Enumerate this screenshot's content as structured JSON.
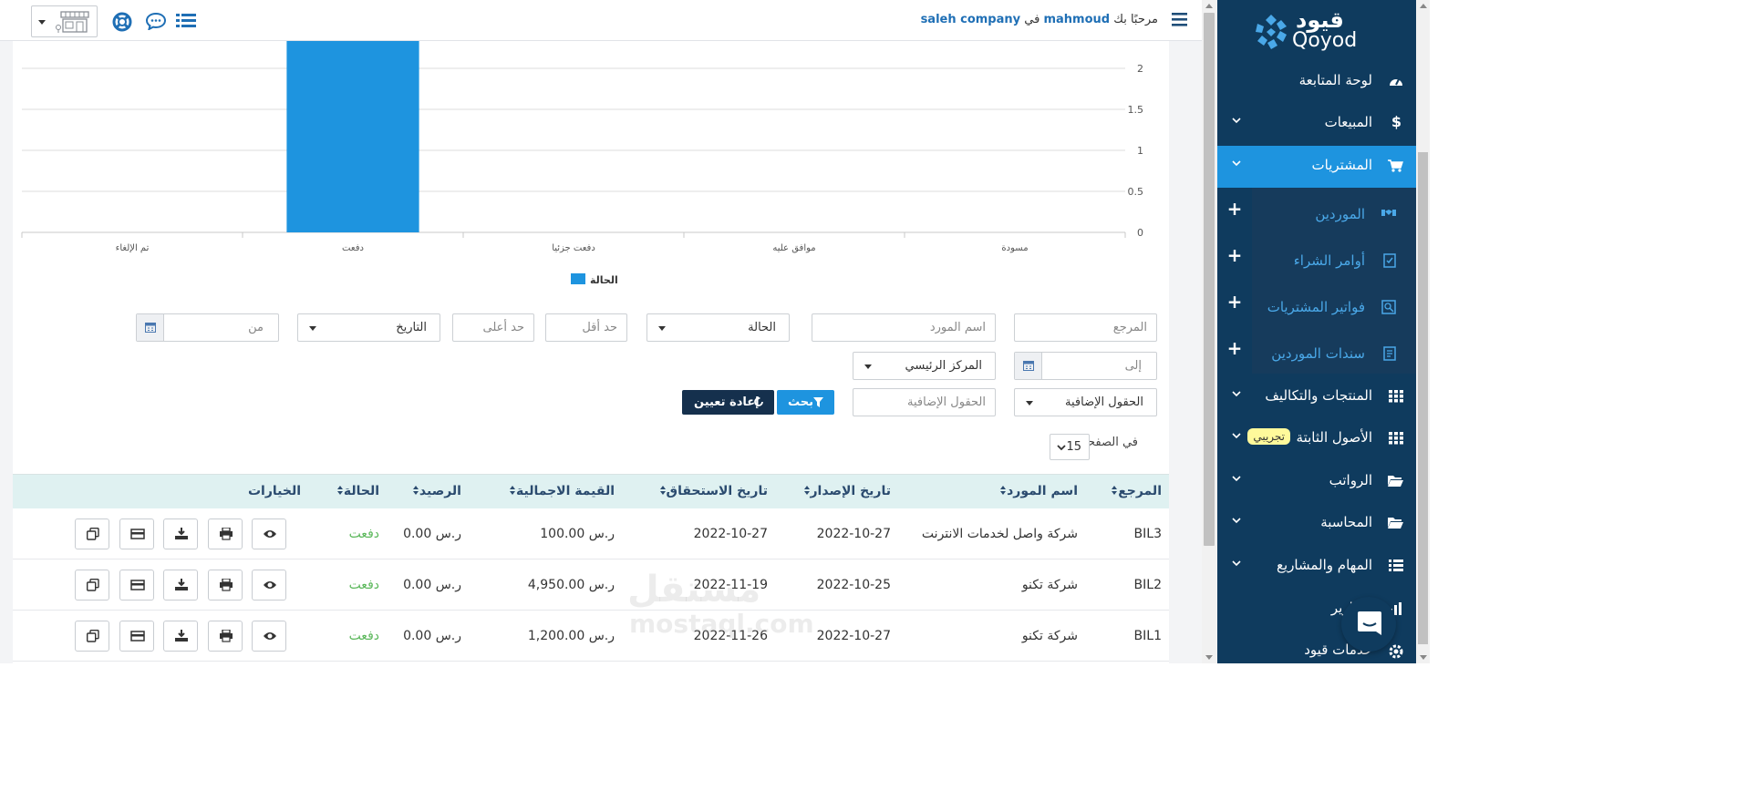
{
  "header": {
    "welcome": "مرحبًا بك",
    "username": "mahmoud",
    "in": "في",
    "company": "saleh company"
  },
  "brand": {
    "logo_ar": "قيود",
    "logo_en": "Qoyod"
  },
  "chart_data": {
    "type": "bar",
    "categories": [
      "مسودة",
      "موافق عليه",
      "دفعت جزئيا",
      "دفعت",
      "تم الإلغاء"
    ],
    "series": [
      {
        "name": "الحالة",
        "values": [
          0,
          0,
          0,
          3,
          0
        ]
      }
    ],
    "ylim": [
      0,
      2.4
    ],
    "yticks": [
      "0",
      "0.5",
      "1",
      "1.5",
      "2"
    ],
    "legend": "bottom-center",
    "grid": true,
    "color": "#1e94df"
  },
  "filters": {
    "reference_ph": "المرجع",
    "supplier_ph": "اسم المورد",
    "status": "الحالة",
    "min_ph": "حد أقل",
    "max_ph": "حد أعلى",
    "date_type": "التاريخ",
    "from_ph": "من",
    "to_ph": "إلى",
    "branch": "المركز الرئيسي",
    "extra_fields": "الحقول الإضافية",
    "extra_fields_ph": "الحقول الإضافية",
    "search": "بحث",
    "reset": "إعادة تعيين"
  },
  "pagination": {
    "per_page_label": "في الصفحة",
    "per_page": "15"
  },
  "table": {
    "headers": {
      "reference": "المرجع",
      "supplier": "اسم المورد",
      "issue_date": "تاريخ الإصدار",
      "due_date": "تاريخ الاستحقاق",
      "total": "القيمة الاجمالية",
      "balance": "الرصيد",
      "status": "الحالة",
      "options": "الخيارات"
    },
    "rows": [
      {
        "reference": "BIL3",
        "supplier": "شركة واصل لخدمات الانترنت",
        "issue_date": "2022-10-27",
        "due_date": "2022-10-27",
        "total": "100.00 ر.س",
        "balance": "0.00 ر.س",
        "status": "دفعت"
      },
      {
        "reference": "BIL2",
        "supplier": "شركة تكنو",
        "issue_date": "2022-10-25",
        "due_date": "2022-11-19",
        "total": "4,950.00 ر.س",
        "balance": "0.00 ر.س",
        "status": "دفعت"
      },
      {
        "reference": "BIL1",
        "supplier": "شركة تكنو",
        "issue_date": "2022-10-27",
        "due_date": "2022-11-26",
        "total": "1,200.00 ر.س",
        "balance": "0.00 ر.س",
        "status": "دفعت"
      }
    ]
  },
  "sidebar": {
    "dashboard": "لوحة المتابعة",
    "sales": "المبيعات",
    "purchases": "المشتريات",
    "suppliers": "الموردين",
    "purchase_orders": "أوامر الشراء",
    "purchase_invoices": "فواتير المشتريات",
    "supplier_receipts": "سندات الموردين",
    "products": "المنتجات والتكاليف",
    "fixed_assets": "الأصول الثابتة",
    "beta_badge": "تجريبي",
    "payroll": "الرواتب",
    "accounting": "المحاسبة",
    "tasks": "المهام والمشاريع",
    "reports": "التقارير",
    "services": "خدمات قيود"
  },
  "watermark": {
    "ar": "مستقل",
    "en": "mostaql.com"
  }
}
